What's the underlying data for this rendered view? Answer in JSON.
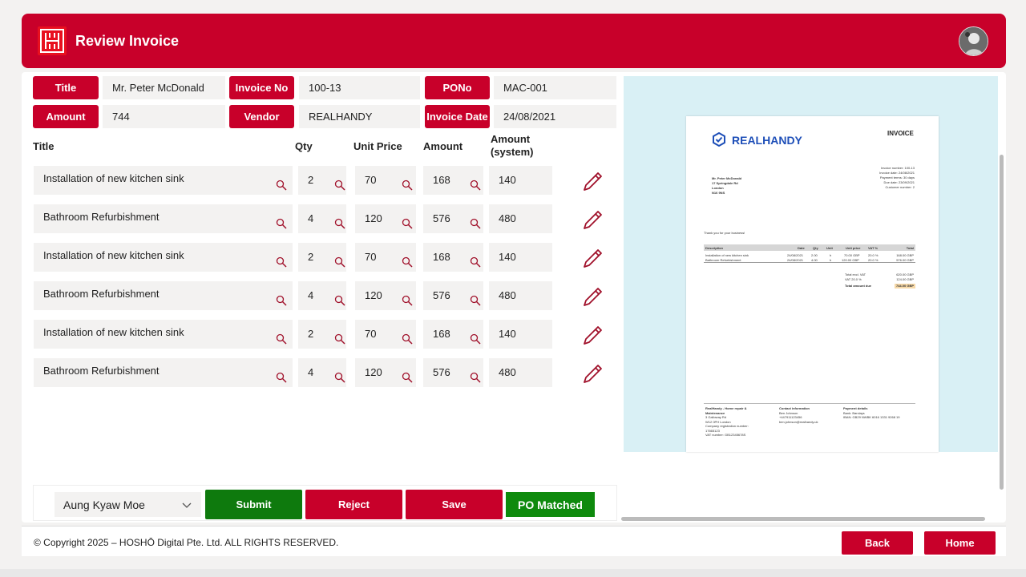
{
  "app": {
    "title": "Review Invoice"
  },
  "fields": {
    "title_label": "Title",
    "title_value": "Mr. Peter McDonald",
    "invoice_no_label": "Invoice No",
    "invoice_no_value": "100-13",
    "pono_label": "PONo",
    "pono_value": "MAC-001",
    "amount_label": "Amount",
    "amount_value": "744",
    "vendor_label": "Vendor",
    "vendor_value": "REALHANDY",
    "invoice_date_label": "Invoice Date",
    "invoice_date_value": "24/08/2021"
  },
  "table": {
    "headers": {
      "title": "Title",
      "qty": "Qty",
      "unit_price": "Unit Price",
      "amount": "Amount",
      "amount_system": "Amount (system)"
    },
    "rows": [
      {
        "title": "Installation of new kitchen sink",
        "qty": "2",
        "unit_price": "70",
        "amount": "168",
        "amount_system": "140"
      },
      {
        "title": "Bathroom Refurbishment",
        "qty": "4",
        "unit_price": "120",
        "amount": "576",
        "amount_system": "480"
      },
      {
        "title": "Installation of new kitchen sink",
        "qty": "2",
        "unit_price": "70",
        "amount": "168",
        "amount_system": "140"
      },
      {
        "title": "Bathroom Refurbishment",
        "qty": "4",
        "unit_price": "120",
        "amount": "576",
        "amount_system": "480"
      },
      {
        "title": "Installation of new kitchen sink",
        "qty": "2",
        "unit_price": "70",
        "amount": "168",
        "amount_system": "140"
      },
      {
        "title": "Bathroom Refurbishment",
        "qty": "4",
        "unit_price": "120",
        "amount": "576",
        "amount_system": "480"
      }
    ]
  },
  "actions": {
    "approver": "Aung Kyaw Moe",
    "submit": "Submit",
    "reject": "Reject",
    "save": "Save",
    "po_status": "PO Matched"
  },
  "preview": {
    "brand": "REALHANDY",
    "doc_type": "INVOICE",
    "customer_lines": [
      "Mr. Peter McDonald",
      "17 Springdale Rd",
      "London",
      "N16 9NS"
    ],
    "meta_lines": [
      "Invoice number: 100-13",
      "Invoice date: 24/08/2021",
      "Payment terms: 30 days",
      "Due date: 23/09/2021",
      "Customer number: 2"
    ],
    "thanks": "Thank you for your business!",
    "item_headers": [
      "Description",
      "Date",
      "Qty",
      "Unit",
      "Unit price",
      "VAT %",
      "Total"
    ],
    "items": [
      [
        "Installation of new kitchen sink",
        "24/08/2021",
        "2.00",
        "h",
        "70.00 GBP",
        "20.0 %",
        "168.00 GBP"
      ],
      [
        "Bathroom Refurbishment",
        "24/08/2021",
        "4.00",
        "h",
        "120.00 GBP",
        "20.0 %",
        "576.00 GBP"
      ]
    ],
    "totals": [
      [
        "Total excl. VAT",
        "620.00 GBP"
      ],
      [
        "VAT 20.0 %",
        "124.00 GBP"
      ]
    ],
    "total_due_label": "Total amount due",
    "total_due_value": "744.00 GBP",
    "footer_col1": [
      "RealHandy - Home repair &",
      "Maintenance",
      "3 Galloway Rd",
      "W12 0PH London",
      "Company registration number:",
      "17665123",
      "VAT number: GB12345678S"
    ],
    "footer_col2": [
      "Contact information",
      "Ben Johnson",
      "+447911123456",
      "ben.johnson@realhandy.uk"
    ],
    "footer_col3": [
      "Payment details",
      "Bank: Barclays",
      "IBAN: GB29 NWBK 6016 1331 9268 19"
    ]
  },
  "footer": {
    "copyright": "© Copyright 2025 – HOSHŌ Digital Pte. Ltd. ALL RIGHTS RESERVED.",
    "back": "Back",
    "home": "Home"
  },
  "colors": {
    "brand_red": "#c8002a",
    "green": "#0e7a0d",
    "preview_bg": "#d9f0f5"
  }
}
